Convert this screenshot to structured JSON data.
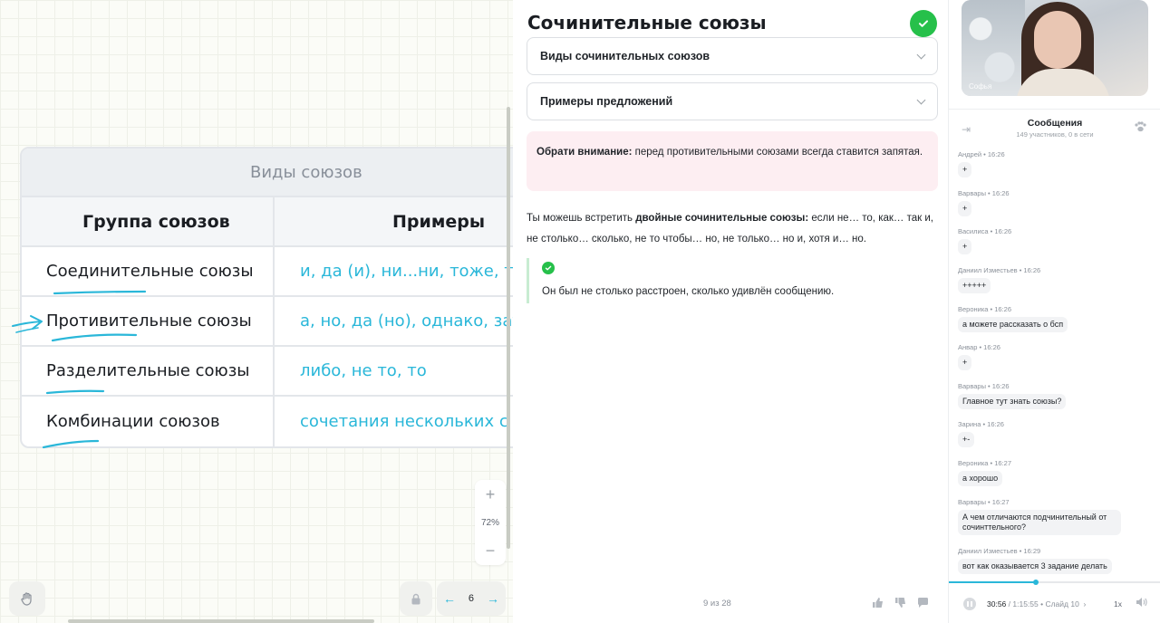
{
  "board": {
    "table": {
      "title": "Виды союзов",
      "headers": [
        "Группа союзов",
        "Примеры"
      ],
      "rows": [
        {
          "group": "Соединительные союзы",
          "examples": "и, да (и), ни...ни, тоже, так"
        },
        {
          "group": "Противительные союзы",
          "examples": "а, но, да (но), однако, зато"
        },
        {
          "group": "Разделительные союзы",
          "examples": "либо, не то, то"
        },
        {
          "group": "Комбинации союзов",
          "examples": "сочетания нескольких с"
        }
      ]
    },
    "zoom": {
      "plus": "+",
      "level": "72%",
      "minus": "−"
    },
    "page": {
      "current": "6",
      "prev": "←",
      "next": "→"
    }
  },
  "lesson": {
    "title": "Сочинительные союзы",
    "accordions": [
      "Виды сочинительных союзов",
      "Примеры предложений"
    ],
    "note": {
      "bold": "Обрати внимание:",
      "text": " перед противительными союзами всегда ставится запятая."
    },
    "body": {
      "pre": "Ты можешь встретить ",
      "bold": "двойные сочинительные союзы:",
      "post": " если не… то, как… так и, не столько… сколько, не то чтобы… но, не только… но и, хотя и… но."
    },
    "example": "Он был не столько расстроен, сколько удивлён сообщению.",
    "counter": "9 из 28"
  },
  "sidebar": {
    "video_name": "Софья",
    "chat_title": "Сообщения",
    "chat_subtitle": "149 участников, 0 в сети",
    "messages": [
      {
        "author": "Андрей • 16:26",
        "text": "+"
      },
      {
        "author": "Варвары • 16:26",
        "text": "+"
      },
      {
        "author": "Василиса • 16:26",
        "text": "+"
      },
      {
        "author": "Даниил Изместьев • 16:26",
        "text": "+++++"
      },
      {
        "author": "Вероника • 16:26",
        "text": "а можете рассказать о бсп"
      },
      {
        "author": "Анвар • 16:26",
        "text": "+"
      },
      {
        "author": "Варвары • 16:26",
        "text": "Главное тут знать союзы?"
      },
      {
        "author": "Зарина • 16:26",
        "text": "+-"
      },
      {
        "author": "Вероника • 16:27",
        "text": "а хорошо"
      },
      {
        "author": "Варвары • 16:27",
        "text": "А чем отличаются подчинительный от сочинттельного?"
      },
      {
        "author": "Даниил Изместьев • 16:29",
        "text": "вот как оказывается 3 задание делать"
      }
    ],
    "player": {
      "time": "30:56",
      "duration": "/ 1:15:55",
      "slide": "• Слайд 10",
      "speed": "1x",
      "progress": 0.41
    }
  }
}
